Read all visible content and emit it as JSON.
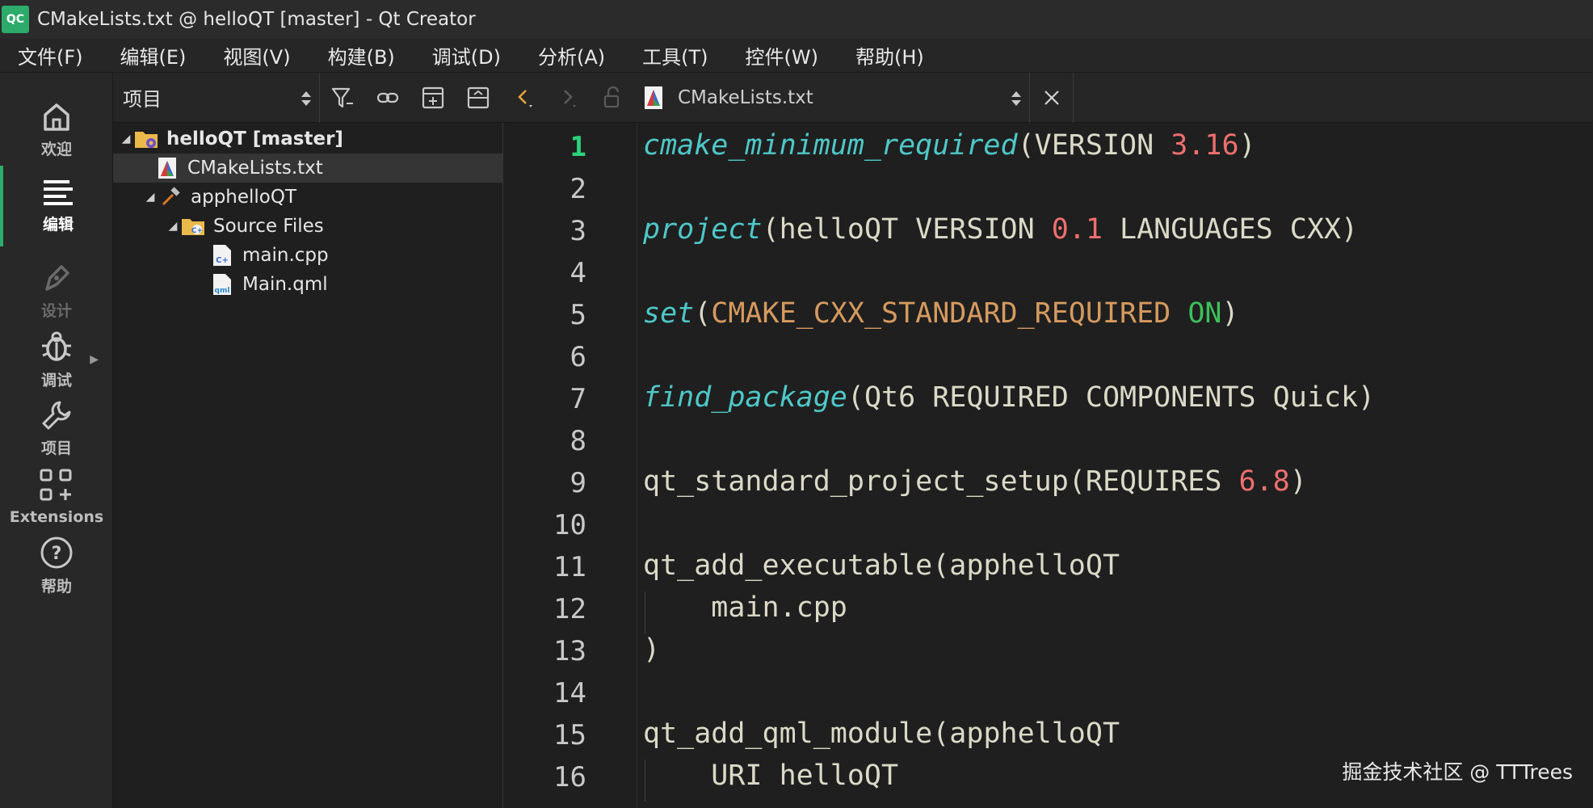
{
  "window": {
    "title": "CMakeLists.txt @ helloQT [master] - Qt Creator",
    "app_icon_text": "QC"
  },
  "menu": [
    "文件(F)",
    "编辑(E)",
    "视图(V)",
    "构建(B)",
    "调试(D)",
    "分析(A)",
    "工具(T)",
    "控件(W)",
    "帮助(H)"
  ],
  "modes": [
    {
      "label": "欢迎",
      "icon": "home-icon"
    },
    {
      "label": "编辑",
      "icon": "edit-lines-icon"
    },
    {
      "label": "设计",
      "icon": "pen-icon"
    },
    {
      "label": "调试",
      "icon": "bug-icon"
    },
    {
      "label": "项目",
      "icon": "wrench-icon"
    },
    {
      "label": "Extensions",
      "icon": "extensions-grid-icon"
    },
    {
      "label": "帮助",
      "icon": "help-circle-icon"
    }
  ],
  "project_panel": {
    "view_selector": "项目",
    "tree": [
      {
        "label": "helloQT [master]",
        "icon": "project-folder-icon",
        "expanded": true,
        "bold": true
      },
      {
        "label": "CMakeLists.txt",
        "icon": "cmake-icon",
        "selected": true
      },
      {
        "label": "apphelloQT",
        "icon": "hammer-icon",
        "expanded": true
      },
      {
        "label": "Source Files",
        "icon": "source-folder-icon",
        "expanded": true
      },
      {
        "label": "main.cpp",
        "icon": "cpp-file-icon"
      },
      {
        "label": "Main.qml",
        "icon": "qml-file-icon"
      }
    ]
  },
  "editor": {
    "current_file": "CMakeLists.txt",
    "current_line": 1,
    "line_numbers": [
      "1",
      "2",
      "3",
      "4",
      "5",
      "6",
      "7",
      "8",
      "9",
      "10",
      "11",
      "12",
      "13",
      "14",
      "15",
      "16"
    ],
    "lines": [
      {
        "tokens": [
          [
            "fn",
            "cmake_minimum_required"
          ],
          [
            "plain",
            "(VERSION "
          ],
          [
            "num",
            "3.16"
          ],
          [
            "plain",
            ")"
          ]
        ]
      },
      {
        "tokens": []
      },
      {
        "tokens": [
          [
            "fn",
            "project"
          ],
          [
            "plain",
            "(helloQT VERSION "
          ],
          [
            "num",
            "0.1"
          ],
          [
            "plain",
            " LANGUAGES CXX)"
          ]
        ]
      },
      {
        "tokens": []
      },
      {
        "tokens": [
          [
            "fn",
            "set"
          ],
          [
            "plain",
            "("
          ],
          [
            "var",
            "CMAKE_CXX_STANDARD_REQUIRED"
          ],
          [
            "plain",
            " "
          ],
          [
            "on",
            "ON"
          ],
          [
            "plain",
            ")"
          ]
        ]
      },
      {
        "tokens": []
      },
      {
        "tokens": [
          [
            "fn",
            "find_package"
          ],
          [
            "plain",
            "(Qt6 REQUIRED COMPONENTS Quick)"
          ]
        ]
      },
      {
        "tokens": []
      },
      {
        "tokens": [
          [
            "plain",
            "qt_standard_project_setup(REQUIRES "
          ],
          [
            "num",
            "6.8"
          ],
          [
            "plain",
            ")"
          ]
        ]
      },
      {
        "tokens": []
      },
      {
        "tokens": [
          [
            "plain",
            "qt_add_executable(apphelloQT"
          ]
        ]
      },
      {
        "tokens": [
          [
            "plain",
            "    main.cpp"
          ]
        ]
      },
      {
        "tokens": [
          [
            "plain",
            ")"
          ]
        ]
      },
      {
        "tokens": []
      },
      {
        "tokens": [
          [
            "plain",
            "qt_add_qml_module(apphelloQT"
          ]
        ]
      },
      {
        "tokens": [
          [
            "plain",
            "    URI helloQT"
          ]
        ]
      }
    ]
  },
  "watermark": "掘金技术社区 @ TTTrees",
  "colors": {
    "accent": "#2dab6b",
    "function": "#4fc7c7",
    "number": "#ef6f6f",
    "variable": "#d59a5f",
    "constant_on": "#3cbf5a"
  }
}
